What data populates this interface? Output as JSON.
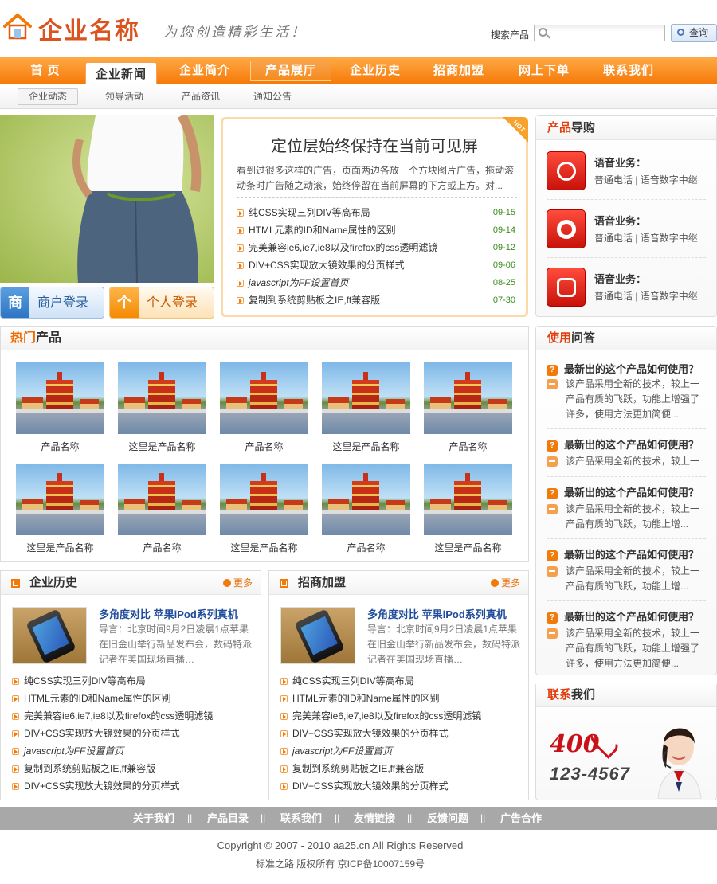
{
  "header": {
    "logo_text": "企业名称",
    "slogan": "为您创造精彩生活！",
    "search_label": "搜索产品",
    "search_placeholder": "",
    "search_button": "查询"
  },
  "nav": {
    "items": [
      "首 页",
      "企业新闻",
      "企业简介",
      "产品展厅",
      "企业历史",
      "招商加盟",
      "网上下单",
      "联系我们"
    ],
    "active": "企业新闻"
  },
  "subnav": {
    "items": [
      "企业动态",
      "领导活动",
      "产品资讯",
      "通知公告"
    ]
  },
  "login": {
    "merchant_icon": "商",
    "merchant_label": "商户登录",
    "personal_icon": "个",
    "personal_label": "个人登录"
  },
  "hot_news": {
    "title": "定位层始终保持在当前可见屏",
    "intro": "看到过很多这样的广告，页面两边各放一个方块图片广告，拖动滚动条时广告随之动滚，始终停留在当前屏幕的下方或上方。对...",
    "tag": "HOT",
    "items": [
      {
        "text": "纯CSS实现三列DIV等高布局",
        "date": "09-15"
      },
      {
        "text": "HTML元素的ID和Name属性的区别",
        "date": "09-14"
      },
      {
        "text": "完美兼容ie6,ie7,ie8以及firefox的css透明滤镜",
        "date": "09-12"
      },
      {
        "text": "DIV+CSS实现放大镜效果的分页样式",
        "date": "09-06"
      },
      {
        "text": "javascript为FF设置首页",
        "date": "08-25"
      },
      {
        "text": "复制到系统剪贴板之IE,ff兼容版",
        "date": "07-30"
      }
    ]
  },
  "product_nav": {
    "title_red": "产品",
    "title_rest": "导购",
    "items": [
      {
        "icon": "headset-icon",
        "title": "语音业务：",
        "desc": "普通电话 | 语音数字中继"
      },
      {
        "icon": "disc-icon",
        "title": "语音业务：",
        "desc": "普通电话 | 语音数字中继"
      },
      {
        "icon": "telephone-icon",
        "title": "语音业务：",
        "desc": "普通电话 | 语音数字中继"
      }
    ]
  },
  "hot_products": {
    "title_red": "热门",
    "title_rest": "产品",
    "items": [
      "产品名称",
      "这里是产品名称",
      "产品名称",
      "这里是产品名称",
      "产品名称",
      "这里是产品名称",
      "产品名称",
      "这里是产品名称",
      "产品名称",
      "这里是产品名称"
    ]
  },
  "qa": {
    "title_red": "使用",
    "title_rest": "问答",
    "q_icon": "?",
    "items": [
      {
        "q": "最新出的这个产品如何使用？",
        "a": "该产品采用全新的技术，较上一产品有质的飞跃，功能上增强了许多，使用方法更加简便..."
      },
      {
        "q": "最新出的这个产品如何使用？",
        "a": "该产品采用全新的技术，较上一"
      },
      {
        "q": "最新出的这个产品如何使用？",
        "a": "该产品采用全新的技术，较上一产品有质的飞跃，功能上增..."
      },
      {
        "q": "最新出的这个产品如何使用？",
        "a": "该产品采用全新的技术，较上一产品有质的飞跃，功能上增..."
      },
      {
        "q": "最新出的这个产品如何使用？",
        "a": "该产品采用全新的技术，较上一产品有质的飞跃，功能上增强了许多，使用方法更加简便..."
      }
    ]
  },
  "history": {
    "title": "企业历史",
    "more": "更多",
    "feature_title": "多角度对比 苹果iPod系列真机",
    "feature_desc": "导言：北京时间9月2日凌晨1点苹果在旧金山举行新品发布会，数码特派记者在美国现场直播…",
    "items": [
      "纯CSS实现三列DIV等高布局",
      "HTML元素的ID和Name属性的区别",
      "完美兼容ie6,ie7,ie8以及firefox的css透明滤镜",
      "DIV+CSS实现放大镜效果的分页样式",
      "javascript为FF设置首页",
      "复制到系统剪贴板之IE,ff兼容版",
      "DIV+CSS实现放大镜效果的分页样式"
    ]
  },
  "franchise": {
    "title": "招商加盟",
    "more": "更多",
    "feature_title": "多角度对比 苹果iPod系列真机",
    "feature_desc": "导言：北京时间9月2日凌晨1点苹果在旧金山举行新品发布会，数码特派记者在美国现场直播…",
    "items": [
      "纯CSS实现三列DIV等高布局",
      "HTML元素的ID和Name属性的区别",
      "完美兼容ie6,ie7,ie8以及firefox的css透明滤镜",
      "DIV+CSS实现放大镜效果的分页样式",
      "javascript为FF设置首页",
      "复制到系统剪贴板之IE,ff兼容版",
      "DIV+CSS实现放大镜效果的分页样式"
    ]
  },
  "contact": {
    "title_red": "联系",
    "title_rest": "我们",
    "hotline_prefix": "400",
    "hotline_number": "123-4567"
  },
  "footer": {
    "links": [
      "关于我们",
      "产品目录",
      "联系我们",
      "友情链接",
      "反馈问题",
      "广告合作"
    ],
    "separator": "||",
    "copyright": "Copyright © 2007 - 2010 aa25.cn   All Rights Reserved",
    "icp": "标准之路  版权所有  京ICP备10007159号"
  },
  "colors": {
    "accent": "#f67a09",
    "brand_red": "#d9541e",
    "link_blue": "#1e4b9a",
    "date_green": "#3a8a1a"
  }
}
